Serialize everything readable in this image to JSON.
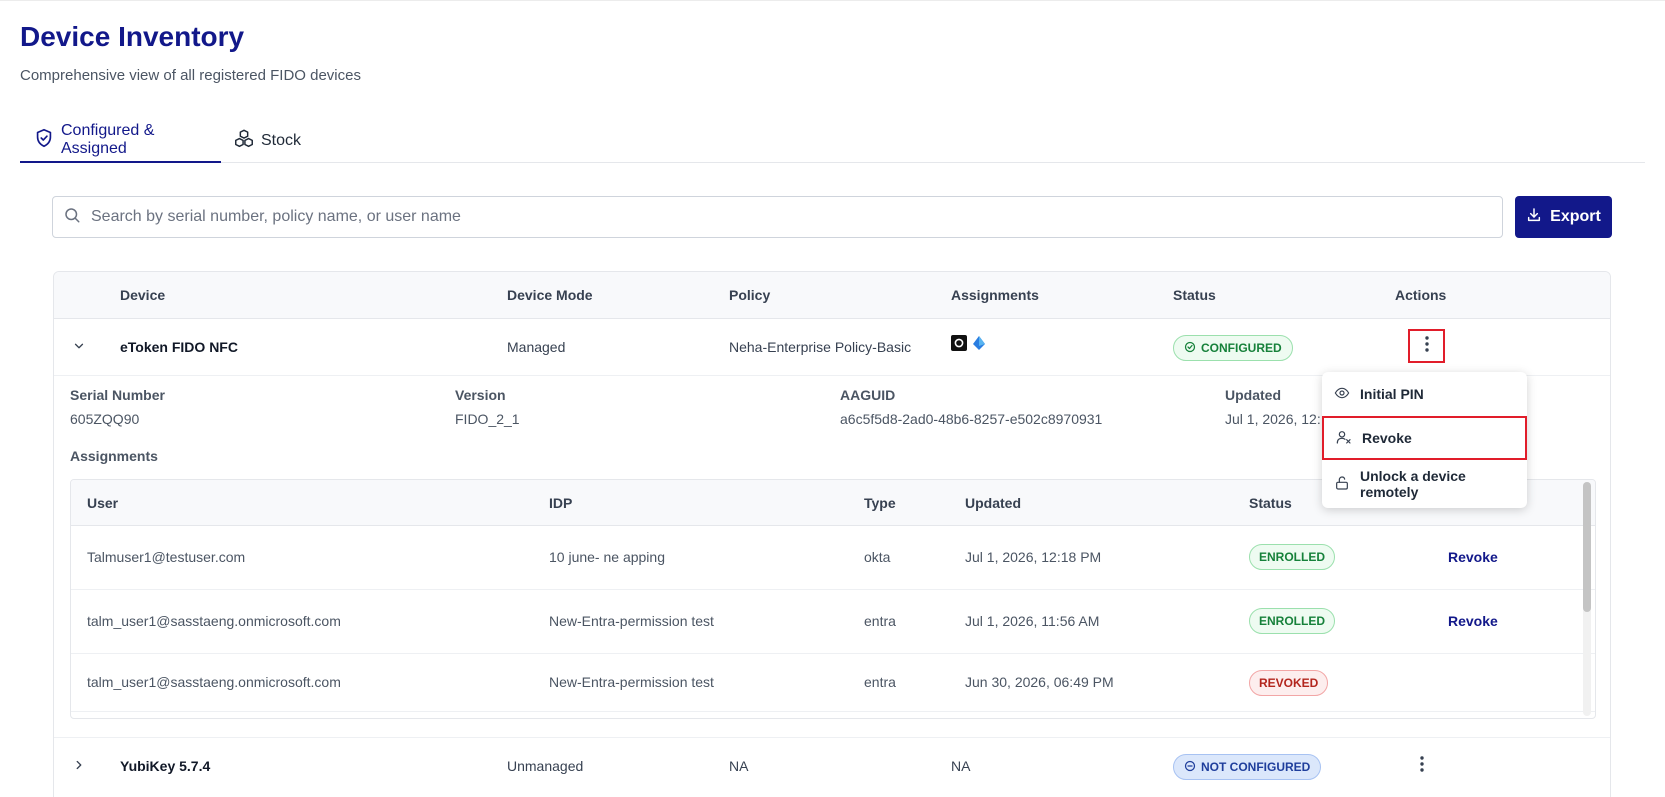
{
  "page": {
    "title": "Device Inventory",
    "subtitle": "Comprehensive view of all registered FIDO devices"
  },
  "tabs": [
    {
      "label": "Configured & Assigned",
      "icon": "shield-check-icon",
      "active": true
    },
    {
      "label": "Stock",
      "icon": "cubes-icon",
      "active": false
    }
  ],
  "search": {
    "placeholder": "Search by serial number, policy name, or user name",
    "value": ""
  },
  "toolbar": {
    "export_label": "Export"
  },
  "table": {
    "headers": [
      "Device",
      "Device Mode",
      "Policy",
      "Assignments",
      "Status",
      "Actions"
    ],
    "rows": [
      {
        "device": "eToken FIDO NFC",
        "mode": "Managed",
        "policy": "Neha-Enterprise Policy-Basic",
        "assignments_icons": [
          "okta-icon",
          "entra-icon"
        ],
        "status": "CONFIGURED",
        "expanded": true
      },
      {
        "device": "YubiKey 5.7.4",
        "mode": "Unmanaged",
        "policy": "NA",
        "assignments": "NA",
        "status": "NOT CONFIGURED",
        "expanded": false
      }
    ]
  },
  "details": {
    "serial_label": "Serial Number",
    "serial_value": "605ZQQ90",
    "version_label": "Version",
    "version_value": "FIDO_2_1",
    "aaguid_label": "AAGUID",
    "aaguid_value": "a6c5f5d8-2ad0-48b6-8257-e502c8970931",
    "updated_label": "Updated",
    "updated_value": "Jul 1, 2026, 12:",
    "assignments_label": "Assignments"
  },
  "assignments_table": {
    "headers": [
      "User",
      "IDP",
      "Type",
      "Updated",
      "Status"
    ],
    "rows": [
      {
        "user": "Talmuser1@testuser.com",
        "idp": "10 june- ne apping",
        "type": "okta",
        "updated": "Jul 1, 2026, 12:18 PM",
        "status": "ENROLLED",
        "action": "Revoke"
      },
      {
        "user": "talm_user1@sasstaeng.onmicrosoft.com",
        "idp": "New-Entra-permission test",
        "type": "entra",
        "updated": "Jul 1, 2026, 11:56 AM",
        "status": "ENROLLED",
        "action": "Revoke"
      },
      {
        "user": "talm_user1@sasstaeng.onmicrosoft.com",
        "idp": "New-Entra-permission test",
        "type": "entra",
        "updated": "Jun 30, 2026, 06:49 PM",
        "status": "REVOKED",
        "action": ""
      }
    ]
  },
  "actions_menu": {
    "items": [
      {
        "label": "Initial PIN",
        "icon": "pin-eye-icon"
      },
      {
        "label": "Revoke",
        "icon": "user-remove-icon",
        "highlighted": true
      },
      {
        "label": "Unlock a device remotely",
        "icon": "unlock-icon"
      }
    ]
  },
  "colors": {
    "brand": "#12188a",
    "highlight": "#e11d2a",
    "configured": "#16813a",
    "not_configured": "#1f3e9c",
    "revoked": "#b3261e"
  }
}
